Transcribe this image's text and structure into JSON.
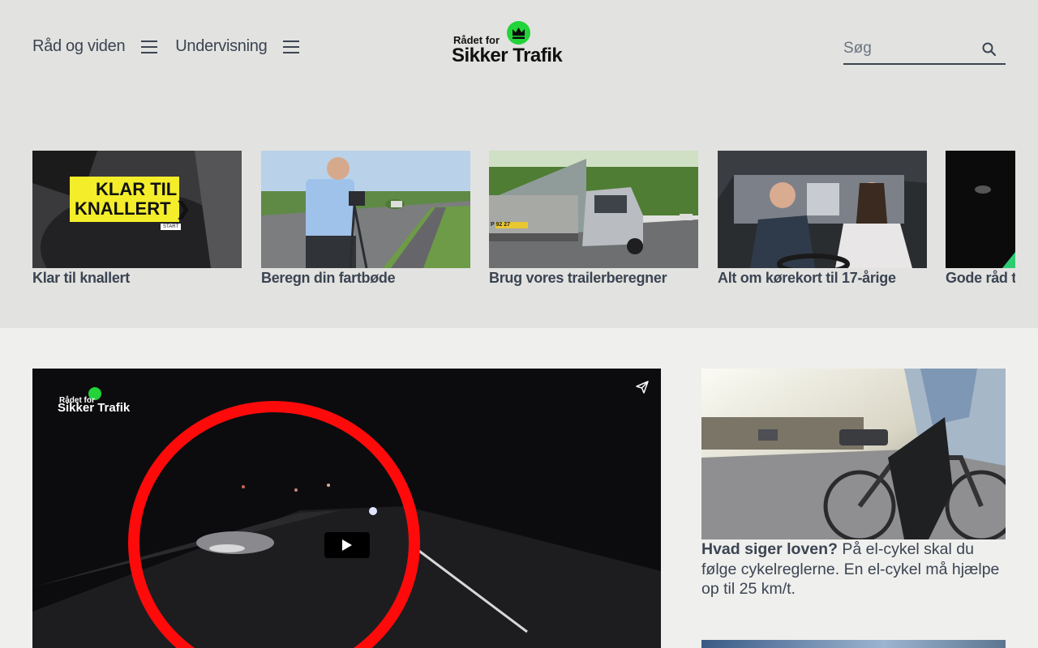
{
  "nav": {
    "link1": "Råd og viden",
    "link2": "Undervisning"
  },
  "logo": {
    "line1": "Rådet for",
    "line2": "Sikker Trafik",
    "brand_green": "#22d33a"
  },
  "search": {
    "placeholder": "Søg"
  },
  "carousel": {
    "items": [
      {
        "title": "Klar til knallert",
        "thumb_text_1": "KLAR TIL",
        "thumb_text_2": "KNALLERT ❯",
        "thumb_badge": "START"
      },
      {
        "title": "Beregn din fartbøde"
      },
      {
        "title": "Brug vores trailerberegner",
        "plate": "P 92 27"
      },
      {
        "title": "Alt om kørekort til 17-årige"
      },
      {
        "title": "Gode råd til"
      }
    ]
  },
  "video": {
    "logo_line1": "Rådet for",
    "logo_line2": "Sikker Trafik"
  },
  "article": {
    "lead": "Hvad siger loven?",
    "body": " På el-cykel skal du følge cykelreglerne. En el-cykel må hjælpe op til 25 km/t."
  },
  "colors": {
    "header_bg": "#e2e2e0",
    "page_bg": "#efefed",
    "text": "#3b4452",
    "accent_yellow": "#f4ee2a",
    "video_ring": "#ff0a0a"
  },
  "icons": [
    "hamburger-icon",
    "search-icon",
    "share-icon",
    "play-icon",
    "crown-icon"
  ]
}
